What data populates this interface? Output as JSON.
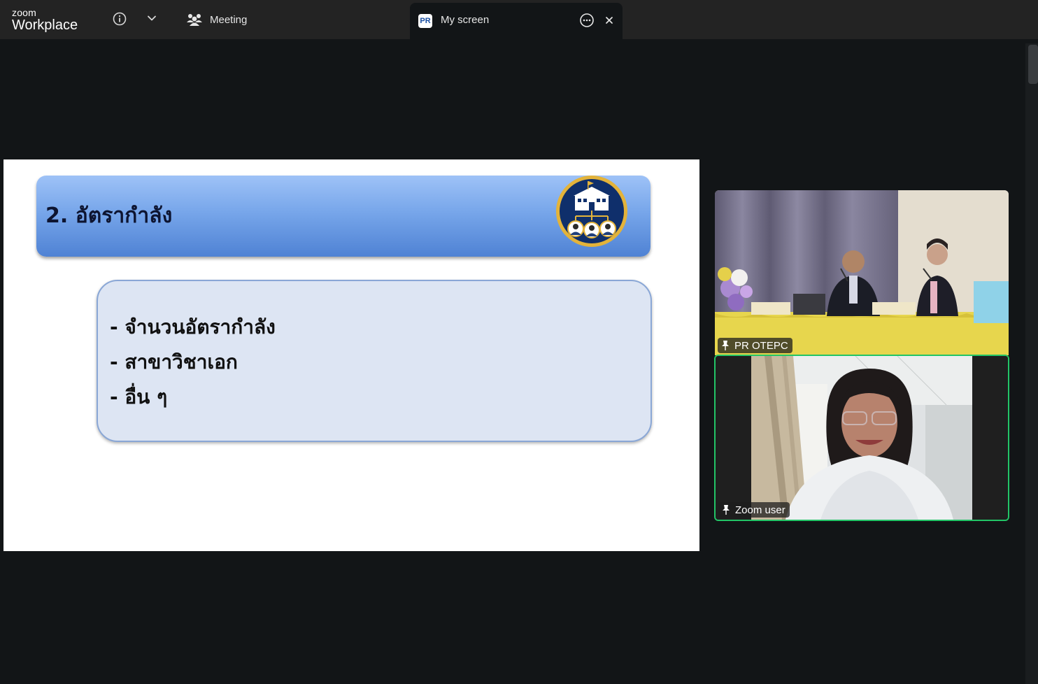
{
  "app": {
    "brand_small": "zoom",
    "brand_big": "Workplace"
  },
  "tabs": {
    "meeting_label": "Meeting",
    "screen_label": "My screen",
    "screen_logo": "PR"
  },
  "slide": {
    "title": "2. อัตรากำลัง",
    "bullets": [
      "- จำนวนอัตรากำลัง",
      "- สาขาวิชาเอก",
      "- อื่น ๆ"
    ]
  },
  "participants": [
    {
      "name": "PR OTEPC",
      "pinned": true,
      "active_speaker": false
    },
    {
      "name": "Zoom user",
      "pinned": true,
      "active_speaker": true
    }
  ],
  "icons": {
    "info": "info-icon",
    "dropdown": "chevron-down-icon",
    "meeting": "participants-icon",
    "more": "more-options-icon",
    "close": "close-icon",
    "pin": "pin-icon",
    "slide_logo": "school-icon"
  },
  "colors": {
    "active_speaker_border": "#22c466",
    "background": "#121517",
    "topbar": "#232323"
  }
}
